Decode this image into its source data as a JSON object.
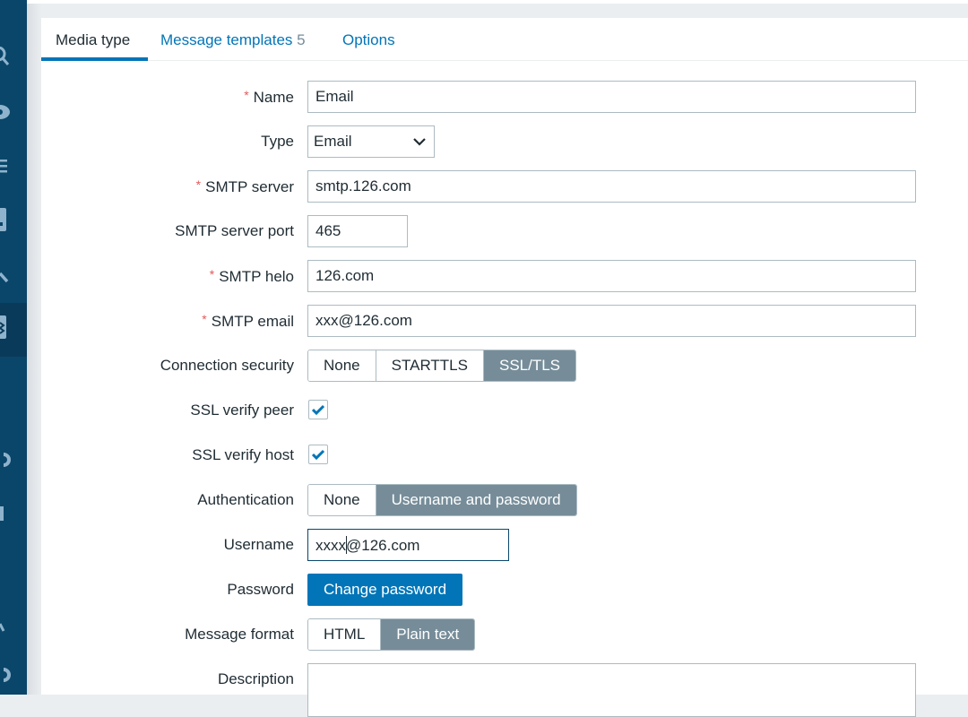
{
  "sidebar": {
    "icons": [
      "search-icon",
      "eye-icon",
      "list-icon",
      "reports-icon",
      "wrench-icon",
      "gear-icon",
      "support-icon",
      "share-icon",
      "user-icon",
      "help-icon"
    ]
  },
  "tabs": [
    {
      "label": "Media type",
      "active": true
    },
    {
      "label": "Message templates",
      "count": "5",
      "active": false
    },
    {
      "label": "Options",
      "active": false
    }
  ],
  "form": {
    "name": {
      "label": "Name",
      "required": true,
      "value": "Email"
    },
    "type": {
      "label": "Type",
      "value": "Email"
    },
    "smtp_server": {
      "label": "SMTP server",
      "required": true,
      "value": "smtp.126.com"
    },
    "smtp_port": {
      "label": "SMTP server port",
      "value": "465"
    },
    "smtp_helo": {
      "label": "SMTP helo",
      "required": true,
      "value": "126.com"
    },
    "smtp_email": {
      "label": "SMTP email",
      "required": true,
      "value": "xxx@126.com"
    },
    "connection_security": {
      "label": "Connection security",
      "options": [
        "None",
        "STARTTLS",
        "SSL/TLS"
      ],
      "selected": "SSL/TLS"
    },
    "ssl_verify_peer": {
      "label": "SSL verify peer",
      "checked": true
    },
    "ssl_verify_host": {
      "label": "SSL verify host",
      "checked": true
    },
    "authentication": {
      "label": "Authentication",
      "options": [
        "None",
        "Username and password"
      ],
      "selected": "Username and password"
    },
    "username": {
      "label": "Username",
      "value_before_caret": "xxxx",
      "value_after_caret": "@126.com"
    },
    "password": {
      "label": "Password",
      "button": "Change password"
    },
    "message_format": {
      "label": "Message format",
      "options": [
        "HTML",
        "Plain text"
      ],
      "selected": "Plain text"
    },
    "description": {
      "label": "Description",
      "value": ""
    }
  },
  "colors": {
    "sidebar": "#0a466a",
    "accent": "#0275b8",
    "segment_active": "#768d99",
    "required": "#e45959"
  }
}
